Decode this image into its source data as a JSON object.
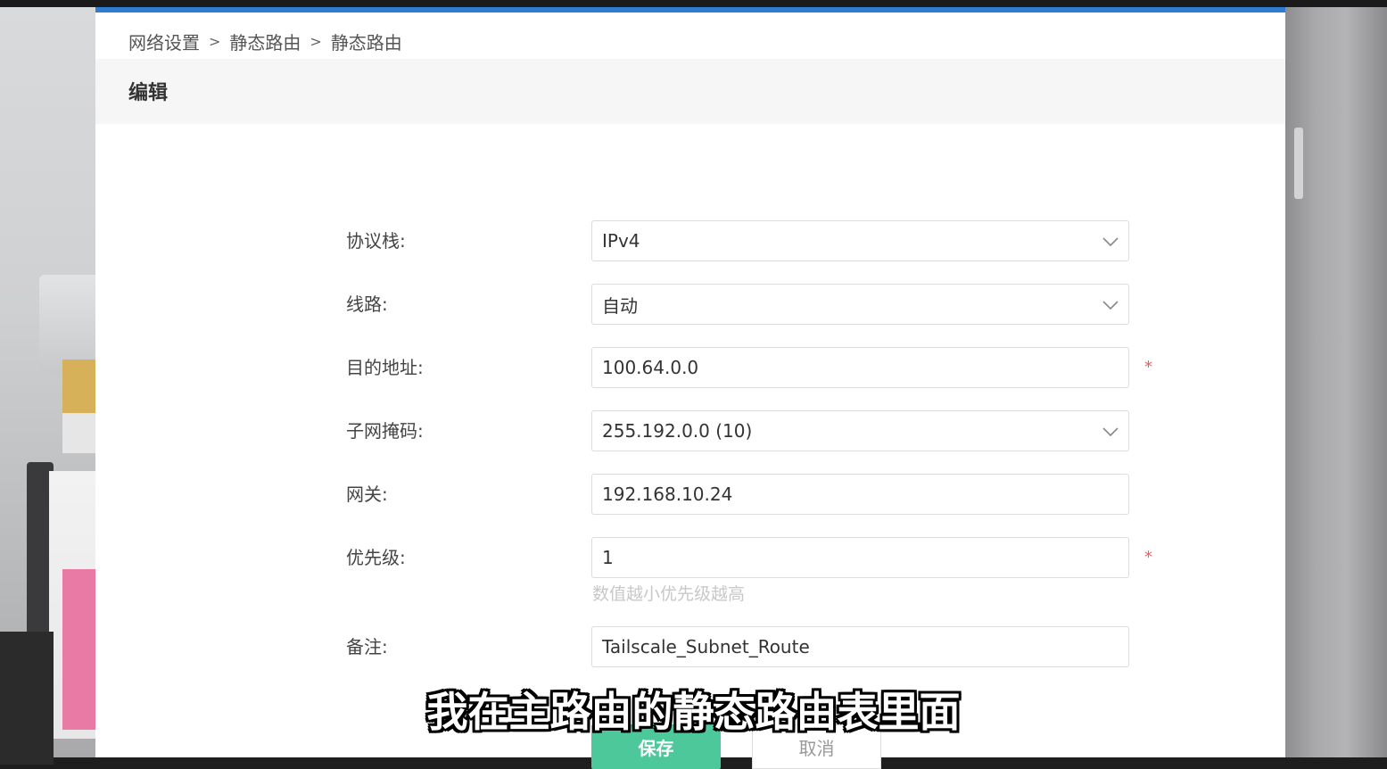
{
  "breadcrumb": [
    "网络设置",
    "静态路由",
    "静态路由"
  ],
  "breadcrumb_sep": ">",
  "page_title": "编辑",
  "form": {
    "protocol": {
      "label": "协议栈:",
      "value": "IPv4",
      "type": "select"
    },
    "line": {
      "label": "线路:",
      "value": "自动",
      "type": "select"
    },
    "destination": {
      "label": "目的地址:",
      "value": "100.64.0.0",
      "required": "*"
    },
    "subnet_mask": {
      "label": "子网掩码:",
      "value": "255.192.0.0 (10)",
      "type": "select"
    },
    "gateway": {
      "label": "网关:",
      "value": "192.168.10.24"
    },
    "priority": {
      "label": "优先级:",
      "value": "1",
      "required": "*",
      "hint": "数值越小优先级越高"
    },
    "remark": {
      "label": "备注:",
      "value": "Tailscale_Subnet_Route"
    }
  },
  "buttons": {
    "save": "保存",
    "cancel": "取消"
  },
  "subtitle": "我在主路由的静态路由表里面",
  "colors": {
    "accent": "#2f7dd1",
    "save_button": "#4cc89a",
    "required": "#f05a5a"
  },
  "icons": {
    "select_arrow": "chevron-down-icon"
  }
}
